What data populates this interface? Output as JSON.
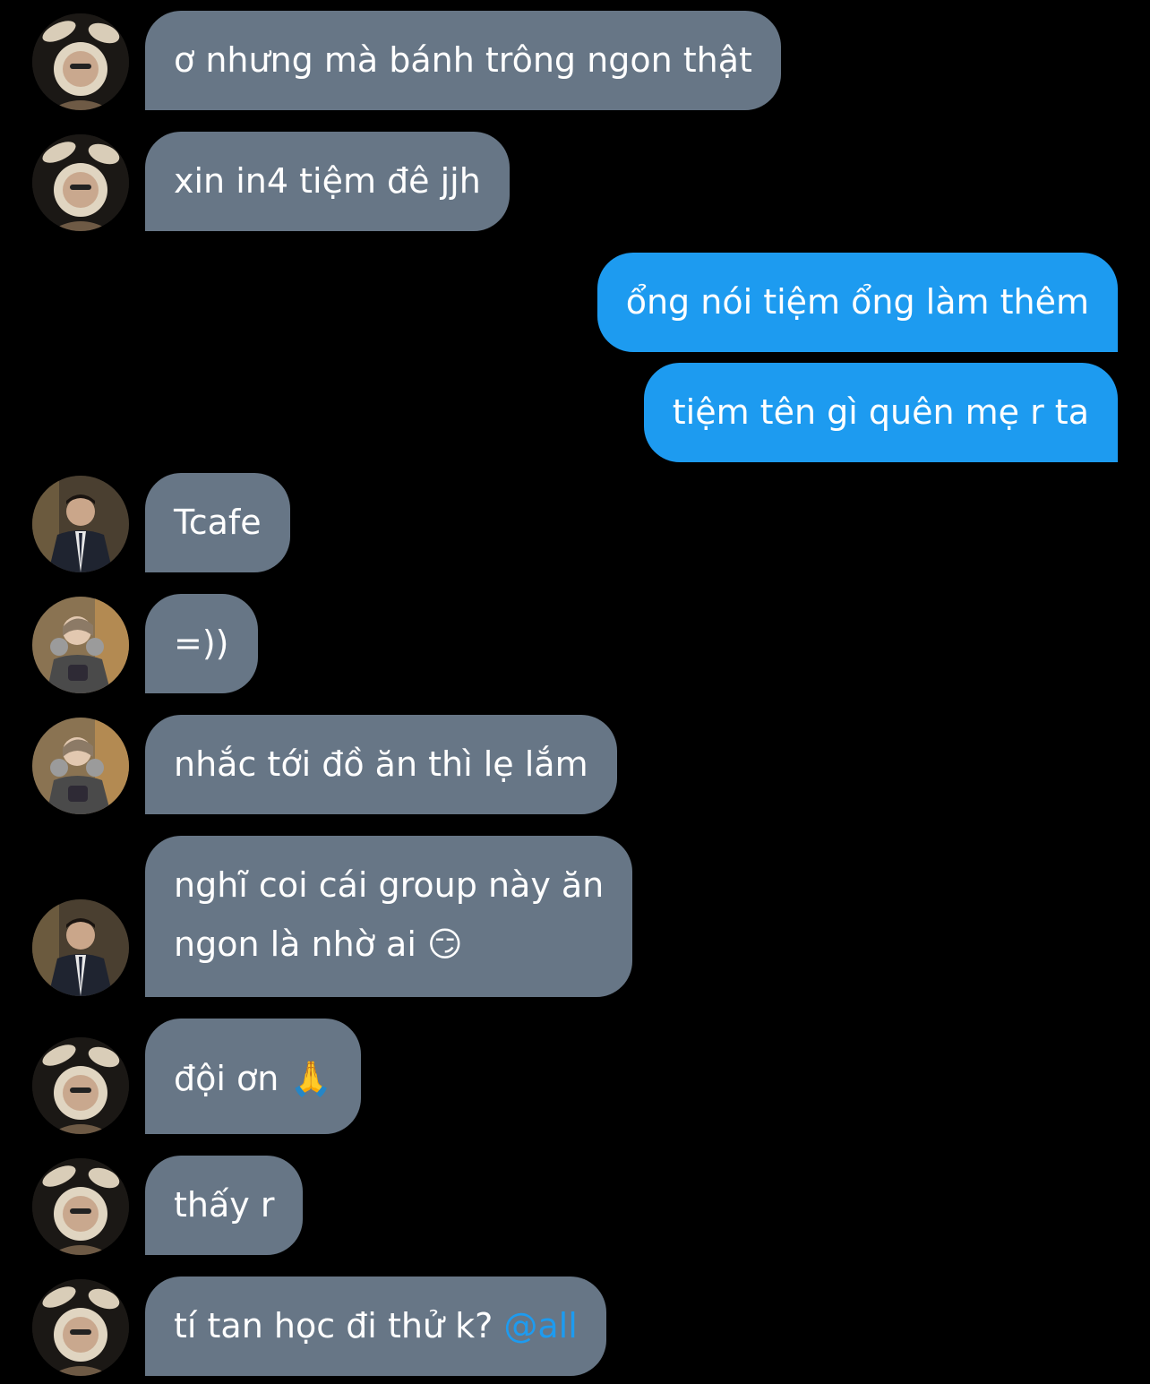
{
  "colors": {
    "background": "#000000",
    "incoming_bubble": "#677686",
    "outgoing_bubble": "#1d9bf0",
    "mention": "#1d9bf0"
  },
  "messages": [
    {
      "sender": "bunny",
      "direction": "incoming",
      "text": "ơ nhưng mà bánh trông ngon thật"
    },
    {
      "sender": "bunny",
      "direction": "incoming",
      "text": "xin in4 tiệm đê jjh"
    },
    {
      "sender": "me",
      "direction": "outgoing",
      "text": "ổng nói tiệm ổng làm thêm"
    },
    {
      "sender": "me",
      "direction": "outgoing",
      "text": "tiệm tên gì quên mẹ r ta"
    },
    {
      "sender": "suit",
      "direction": "incoming",
      "text": "Tcafe"
    },
    {
      "sender": "glasses",
      "direction": "incoming",
      "text": "=))"
    },
    {
      "sender": "glasses",
      "direction": "incoming",
      "text": "nhắc tới đồ ăn thì lẹ lắm"
    },
    {
      "sender": "suit",
      "direction": "incoming",
      "text_line1": "nghĩ coi cái group này ăn",
      "text_line2": "ngon là nhờ ai",
      "emoji": "😏"
    },
    {
      "sender": "bunny",
      "direction": "incoming",
      "text": "đội ơn",
      "emoji": "🙏"
    },
    {
      "sender": "bunny",
      "direction": "incoming",
      "text": "thấy r"
    },
    {
      "sender": "bunny",
      "direction": "incoming",
      "text": "tí tan học đi thử k?",
      "mention": "@all"
    }
  ]
}
